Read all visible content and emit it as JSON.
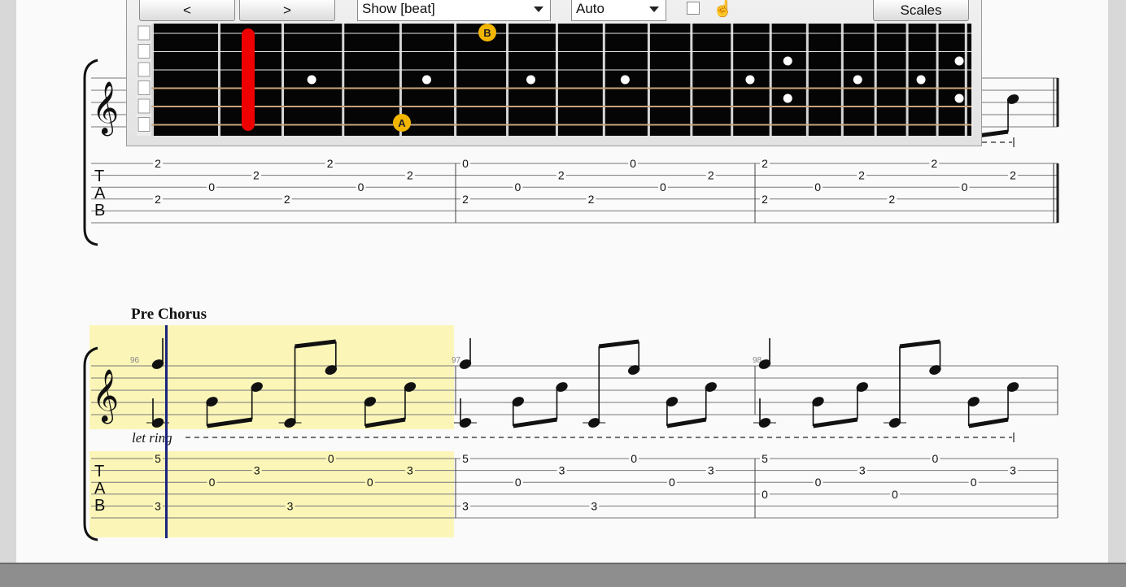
{
  "toolbar": {
    "prev_label": "<",
    "next_label": ">",
    "show_value": "Show [beat]",
    "mode_value": "Auto",
    "scales_label": "Scales"
  },
  "fretboard": {
    "markers": [
      "B",
      "A"
    ],
    "colors": {
      "board": "#050505",
      "highlight": "#ee0000",
      "marker": "#f2b600"
    }
  },
  "score": {
    "section_label": "Pre Chorus",
    "let_ring": "let ring",
    "clef_tab": [
      "T",
      "A",
      "B"
    ],
    "measure_numbers": [
      "96",
      "97",
      "98"
    ],
    "top_system": {
      "measures": [
        {
          "notes": [
            {
              "s": 1,
              "f": "2"
            },
            {
              "s": 4,
              "f": "2"
            },
            {
              "s": 3,
              "f": "0"
            },
            {
              "s": 2,
              "f": "2"
            },
            {
              "s": 4,
              "f": "2"
            },
            {
              "s": 1,
              "f": "2"
            },
            {
              "s": 3,
              "f": "0"
            },
            {
              "s": 2,
              "f": "2"
            }
          ]
        },
        {
          "notes": [
            {
              "s": 1,
              "f": "0"
            },
            {
              "s": 4,
              "f": "2"
            },
            {
              "s": 3,
              "f": "0"
            },
            {
              "s": 2,
              "f": "2"
            },
            {
              "s": 4,
              "f": "2"
            },
            {
              "s": 1,
              "f": "0"
            },
            {
              "s": 3,
              "f": "0"
            },
            {
              "s": 2,
              "f": "2"
            }
          ]
        },
        {
          "notes": [
            {
              "s": 1,
              "f": "2"
            },
            {
              "s": 4,
              "f": "2"
            },
            {
              "s": 3,
              "f": "0"
            },
            {
              "s": 2,
              "f": "2"
            },
            {
              "s": 4,
              "f": "2"
            },
            {
              "s": 1,
              "f": "2"
            },
            {
              "s": 3,
              "f": "0"
            },
            {
              "s": 2,
              "f": "2"
            }
          ]
        }
      ]
    },
    "bottom_system": {
      "measures": [
        {
          "notes": [
            {
              "s": 1,
              "f": "5"
            },
            {
              "s": 5,
              "f": "3"
            },
            {
              "s": 3,
              "f": "0"
            },
            {
              "s": 2,
              "f": "3"
            },
            {
              "s": 5,
              "f": "3"
            },
            {
              "s": 1,
              "f": "0"
            },
            {
              "s": 3,
              "f": "0"
            },
            {
              "s": 2,
              "f": "3"
            }
          ]
        },
        {
          "notes": [
            {
              "s": 1,
              "f": "5"
            },
            {
              "s": 5,
              "f": "3"
            },
            {
              "s": 3,
              "f": "0"
            },
            {
              "s": 2,
              "f": "3"
            },
            {
              "s": 5,
              "f": "3"
            },
            {
              "s": 1,
              "f": "0"
            },
            {
              "s": 3,
              "f": "0"
            },
            {
              "s": 2,
              "f": "3"
            }
          ]
        },
        {
          "notes": [
            {
              "s": 1,
              "f": "5"
            },
            {
              "s": 4,
              "f": "0"
            },
            {
              "s": 3,
              "f": "0"
            },
            {
              "s": 2,
              "f": "3"
            },
            {
              "s": 4,
              "f": "0"
            },
            {
              "s": 1,
              "f": "0"
            },
            {
              "s": 3,
              "f": "0"
            },
            {
              "s": 2,
              "f": "3"
            }
          ]
        }
      ]
    },
    "highlight_color": "#fbf6b8",
    "cursor_color": "#1a237e"
  }
}
